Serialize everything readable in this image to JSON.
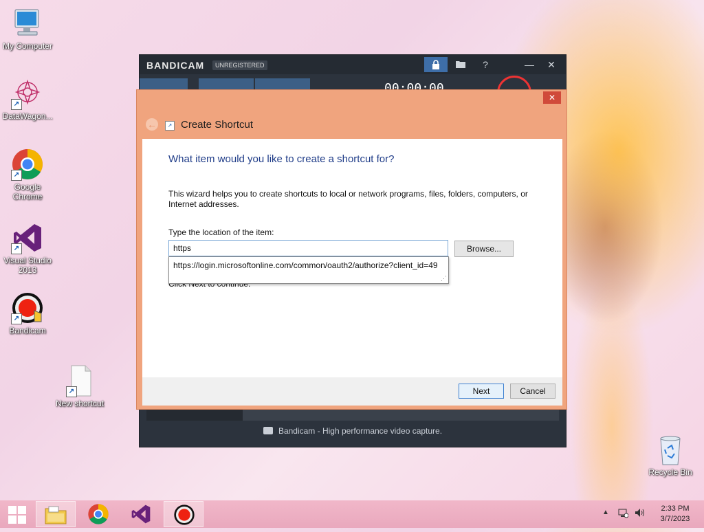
{
  "desktop": {
    "icons": [
      {
        "label": "My Computer"
      },
      {
        "label": "DataWagon..."
      },
      {
        "label": "Google Chrome"
      },
      {
        "label": "Visual Studio 2013"
      },
      {
        "label": "Bandicam"
      },
      {
        "label": "New shortcut"
      },
      {
        "label": "Recycle Bin"
      }
    ]
  },
  "bandicam": {
    "logo": "BANDICAM",
    "badge": "UNREGISTERED",
    "timer": "00:00:00",
    "footer_text": "Bandicam - High performance video capture.",
    "title_buttons": {
      "help": "?",
      "minimize": "—",
      "close": "✕"
    }
  },
  "dialog": {
    "window_title": "Create Shortcut",
    "heading": "What item would you like to create a shortcut for?",
    "description": "This wizard helps you to create shortcuts to local or network programs, files, folders, computers, or Internet addresses.",
    "location_label": "Type the location of the item:",
    "location_value": "https",
    "browse_label": "Browse...",
    "next_hint": "Click Next to continue.",
    "autocomplete_suggestion": "https://login.microsoftonline.com/common/oauth2/authorize?client_id=49",
    "next_label": "Next",
    "cancel_label": "Cancel",
    "close_glyph": "✕"
  },
  "taskbar": {
    "time": "2:33 PM",
    "date": "3/7/2023"
  },
  "colors": {
    "dialog_frame": "#f0a47e",
    "heading_blue": "#1f3c88",
    "bandicam_bg": "#2c333d",
    "taskbar_pink": "#eeb0c4"
  }
}
